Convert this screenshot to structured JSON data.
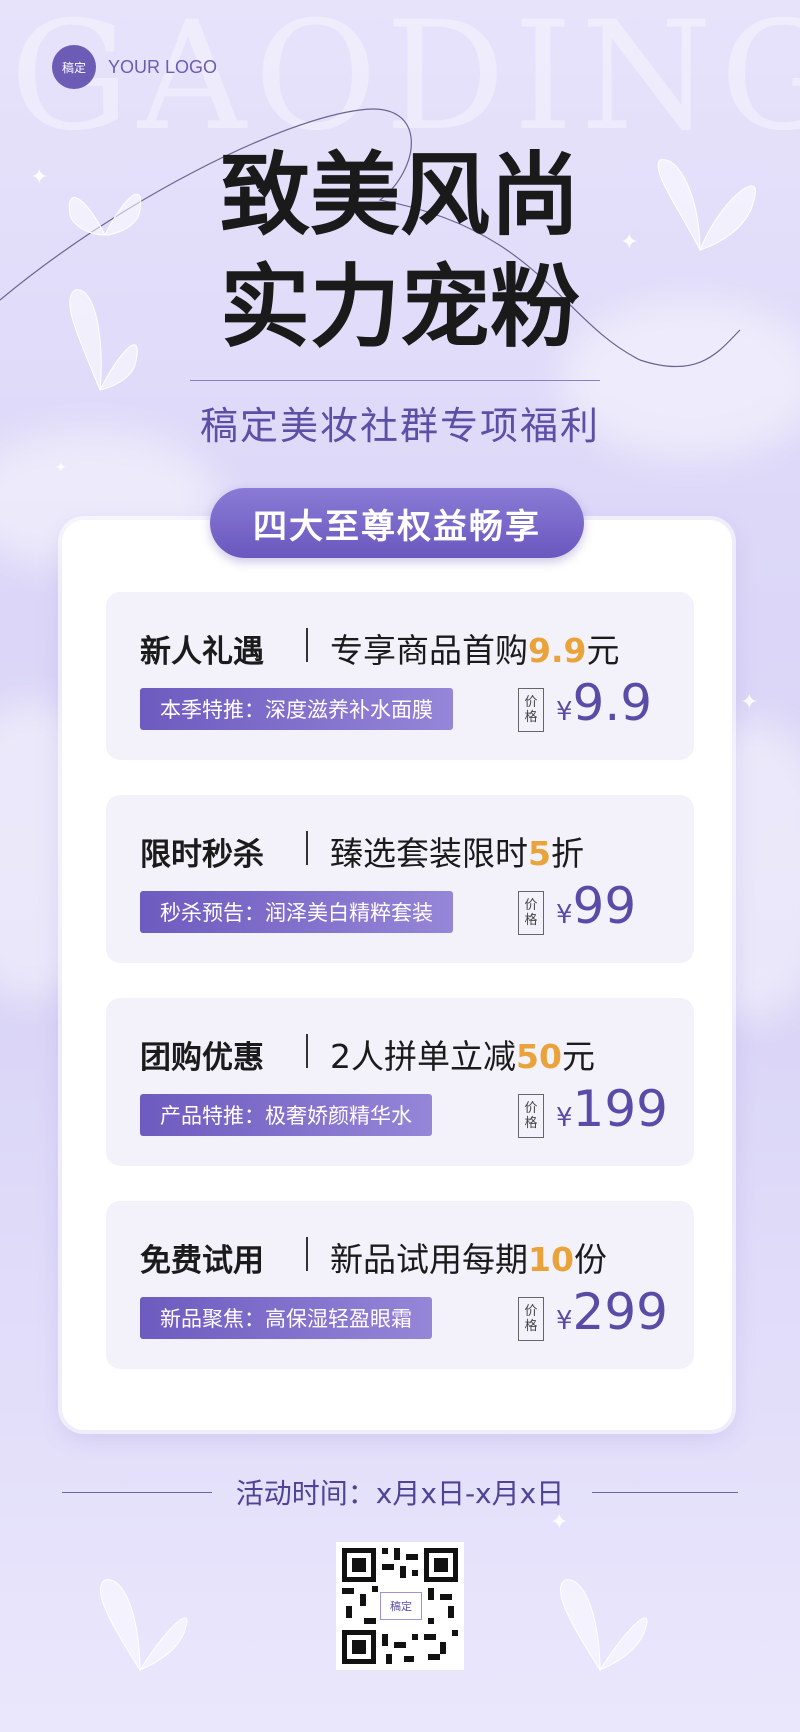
{
  "background_word": "GAODING",
  "logo": {
    "badge": "稿定",
    "text": "YOUR LOGO"
  },
  "title": {
    "line1": "致美风尚",
    "line2": "实力宠粉"
  },
  "subtitle": "稿定美妆社群专项福利",
  "banner": "四大至尊权益畅享",
  "price_box": {
    "char1": "价",
    "char2": "格"
  },
  "currency": "¥",
  "items": [
    {
      "name": "新人礼遇",
      "desc_prefix": "专享商品首购",
      "desc_highlight": "9.9",
      "desc_suffix": "元",
      "tag": "本季特推：深度滋养补水面膜",
      "price": "9.9"
    },
    {
      "name": "限时秒杀",
      "desc_prefix": "臻选套装限时",
      "desc_highlight": "5",
      "desc_suffix": "折",
      "tag": "秒杀预告：润泽美白精粹套装",
      "price": "99"
    },
    {
      "name": "团购优惠",
      "desc_prefix": "2人拼单立减",
      "desc_highlight": "50",
      "desc_suffix": "元",
      "tag": "产品特推：极奢娇颜精华水",
      "price": "199"
    },
    {
      "name": "免费试用",
      "desc_prefix": "新品试用每期",
      "desc_highlight": "10",
      "desc_suffix": "份",
      "tag": "新品聚焦：高保湿轻盈眼霜",
      "price": "299"
    }
  ],
  "footer": "活动时间：x月x日-x月x日",
  "qr_label": "稿定",
  "colors": {
    "accent": "#6c5cb6",
    "highlight": "#e9a33a",
    "price": "#5a4ba6",
    "background": "#ddd8f8"
  }
}
